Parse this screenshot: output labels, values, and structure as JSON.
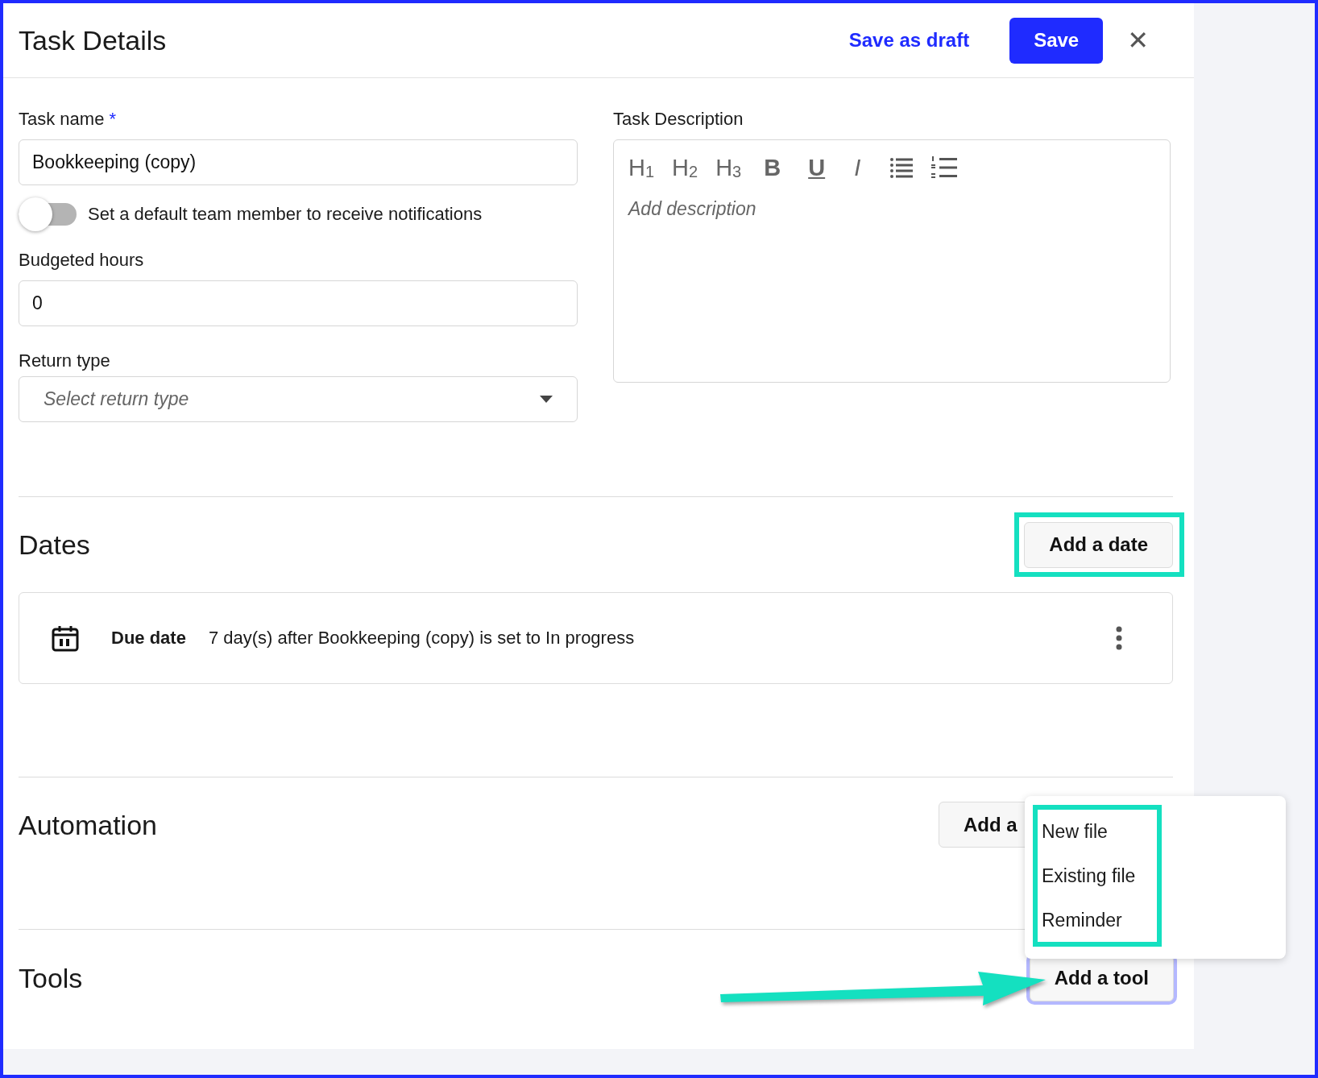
{
  "header": {
    "title": "Task Details",
    "draft_link": "Save as draft",
    "save_button": "Save",
    "close": "✕"
  },
  "task_name": {
    "label": "Task name",
    "required_mark": "*",
    "value": "Bookkeeping (copy)"
  },
  "notify_toggle": {
    "label": "Set a default team member to receive notifications",
    "on": false
  },
  "budgeted_hours": {
    "label": "Budgeted hours",
    "value": "0"
  },
  "return_type": {
    "label": "Return type",
    "placeholder": "Select return type"
  },
  "description": {
    "label": "Task Description",
    "placeholder": "Add description",
    "toolbar": [
      {
        "kind": "heading",
        "label": "H$_{1}$"
      },
      {
        "kind": "heading",
        "label": "H$_{2}$"
      },
      {
        "kind": "heading",
        "label": "H$_{3}$"
      },
      {
        "kind": "bold",
        "label": "B"
      },
      {
        "kind": "underline",
        "label": "U"
      },
      {
        "kind": "italic",
        "label": "I"
      },
      {
        "kind": "bullet-list"
      },
      {
        "kind": "numbered-list"
      }
    ]
  },
  "dates": {
    "title": "Dates",
    "add_button": "Add a date",
    "items": [
      {
        "type": "Due date",
        "rule": "7 day(s) after Bookkeeping (copy) is set to In progress"
      }
    ]
  },
  "automation": {
    "title": "Automation",
    "add_button": "Add a"
  },
  "tools": {
    "title": "Tools",
    "add_button": "Add a tool",
    "menu": [
      "New file",
      "Existing file",
      "Reminder"
    ]
  }
}
